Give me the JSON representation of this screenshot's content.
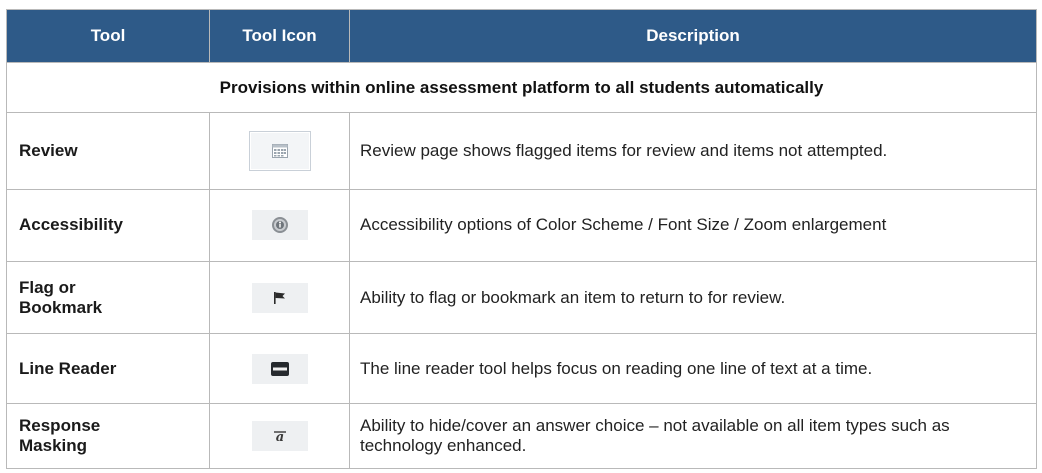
{
  "header": {
    "tool": "Tool",
    "tool_icon": "Tool Icon",
    "description": "Description"
  },
  "section_title": "Provisions within online assessment platform to all students automatically",
  "rows": [
    {
      "tool": "Review",
      "icon": "calendar-grid-icon",
      "description": "Review page shows flagged items for review and items not attempted."
    },
    {
      "tool": "Accessibility",
      "icon": "accessibility-circle-icon",
      "description": "Accessibility options of Color Scheme / Font Size / Zoom enlargement"
    },
    {
      "tool": "Flag or\nBookmark",
      "icon": "flag-icon",
      "description": "Ability to flag or bookmark an item to return to for review."
    },
    {
      "tool": "Line Reader",
      "icon": "line-reader-icon",
      "description": "The line reader tool helps focus on reading one line of text at a time."
    },
    {
      "tool": "Response\nMasking",
      "icon": "answer-masking-icon",
      "description": "Ability to hide/cover an answer choice – not available on all item types such as technology enhanced."
    }
  ],
  "colors": {
    "header_bg": "#2e5a88",
    "header_text": "#ffffff",
    "border": "#b9b9b9"
  }
}
